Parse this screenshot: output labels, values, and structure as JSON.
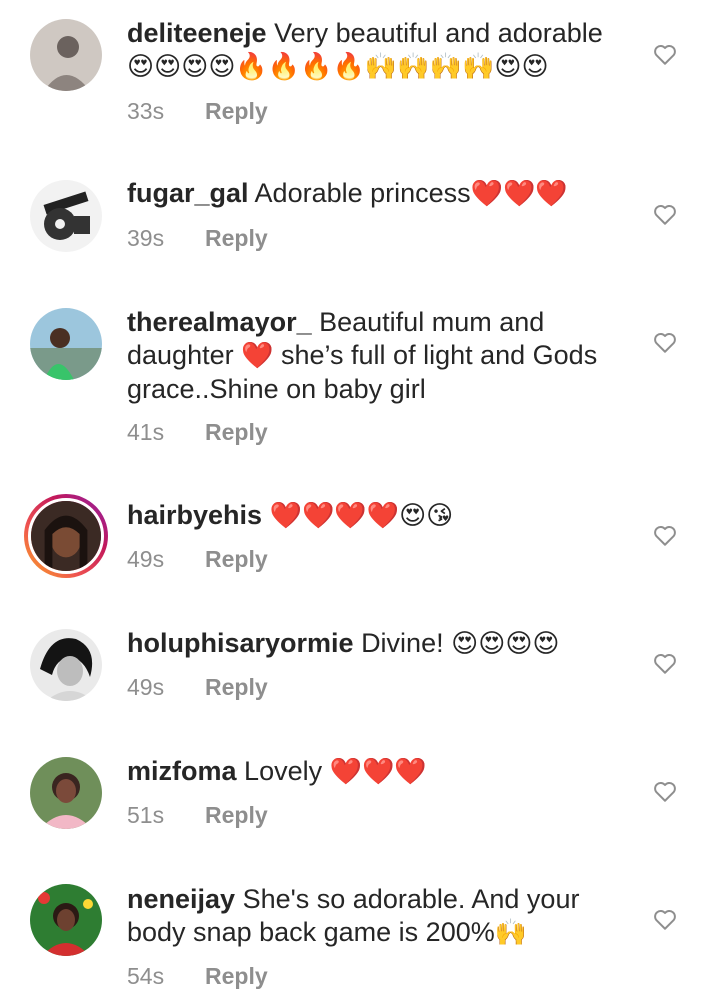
{
  "reply_label": "Reply",
  "comments": [
    {
      "username": "deliteeneje",
      "text": "Very beautiful and adorable",
      "emojis": "😍😍😍😍🔥🔥🔥🔥🙌🙌🙌🙌😍😍",
      "time": "33s"
    },
    {
      "username": "fugar_gal",
      "text": "Adorable princess",
      "emojis": "❤️❤️❤️",
      "time": "39s"
    },
    {
      "username": "therealmayor_",
      "text": "Beautiful mum and daughter",
      "emojis": "❤️",
      "text2": "she’s full of light and Gods grace..Shine on baby girl",
      "time": "41s"
    },
    {
      "username": "hairbyehis",
      "text": "",
      "emojis": "❤️❤️❤️❤️😍😘",
      "time": "49s"
    },
    {
      "username": "holuphisaryormie",
      "text": "Divine!",
      "emojis": "😍😍😍😍",
      "time": "49s"
    },
    {
      "username": "mizfoma",
      "text": "Lovely",
      "emojis": "❤️❤️❤️",
      "time": "51s"
    },
    {
      "username": "neneijay",
      "text": "She's so adorable. And your body snap back game is 200%",
      "emojis": "🙌",
      "time": "54s"
    }
  ],
  "icons": {
    "like": "heart-outline-icon"
  },
  "colors": {
    "meta": "#8e8e8e",
    "text": "#262626",
    "story_ring": "#c2185b"
  }
}
